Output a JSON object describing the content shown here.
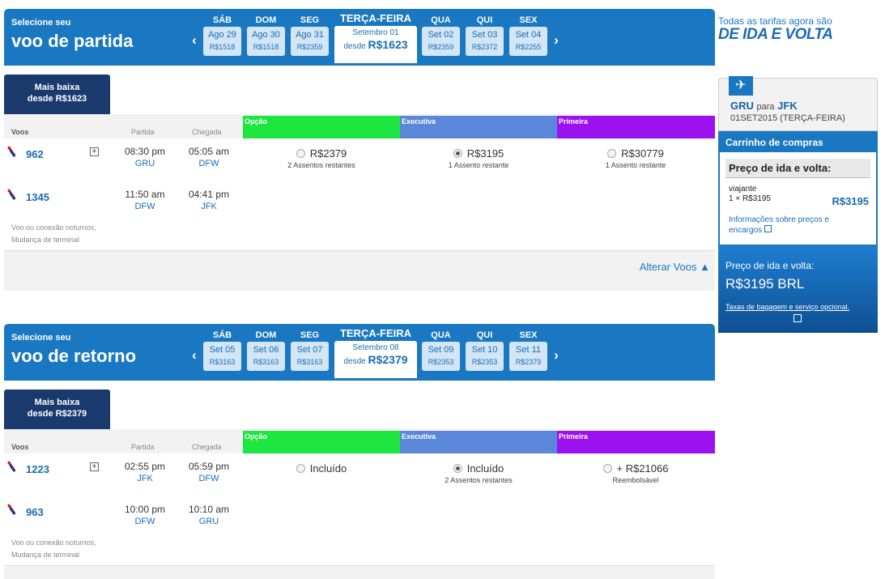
{
  "banner": {
    "line1": "Todas as tarifas agora são",
    "line2": "DE IDA E VOLTA"
  },
  "columns": {
    "flights": "Voos",
    "departure": "Partida",
    "arrival": "Chegada"
  },
  "cabins": [
    {
      "name": "Opção",
      "color": "#1ee640"
    },
    {
      "name": "Executiva",
      "color": "#5a87d9"
    },
    {
      "name": "Primeira",
      "color": "#9b11ef"
    }
  ],
  "outbound": {
    "subtitle": "Selecione seu",
    "title": "voo de partida",
    "days": [
      {
        "name": "SÁB",
        "date": "Ago 29",
        "price": "R$1518"
      },
      {
        "name": "DOM",
        "date": "Ago 30",
        "price": "R$1518"
      },
      {
        "name": "SEG",
        "date": "Ago 31",
        "price": "R$2359"
      }
    ],
    "selected": {
      "name": "TERÇA-FEIRA",
      "date": "Setembro 01",
      "prefix": "desde",
      "price": "R$1623"
    },
    "days_after": [
      {
        "name": "QUA",
        "date": "Set 02",
        "price": "R$2359"
      },
      {
        "name": "QUI",
        "date": "Set 03",
        "price": "R$2372"
      },
      {
        "name": "SEX",
        "date": "Set 04",
        "price": "R$2255"
      }
    ],
    "lowest": {
      "line1": "Mais baixa",
      "line2": "desde R$1623"
    },
    "segments": [
      {
        "flight": "962",
        "dep_time": "08:30 pm",
        "dep_code": "GRU",
        "arr_time": "05:05 am",
        "arr_code": "DFW"
      },
      {
        "flight": "1345",
        "dep_time": "11:50 am",
        "dep_code": "DFW",
        "arr_time": "04:41 pm",
        "arr_code": "JFK"
      }
    ],
    "options": [
      {
        "price": "R$2379",
        "sub": "2 Assentos restantes",
        "selected": false
      },
      {
        "price": "R$3195",
        "sub": "1 Assento restante",
        "selected": true
      },
      {
        "price": "R$30779",
        "sub": "1 Assento restante",
        "selected": false
      }
    ],
    "note1": "Voo ou conexão noturnos,",
    "note2": "Mudança de terminal",
    "change": "Alterar Voos ▲"
  },
  "return": {
    "subtitle": "Selecione seu",
    "title": "voo de retorno",
    "days": [
      {
        "name": "SÁB",
        "date": "Set 05",
        "price": "R$3163"
      },
      {
        "name": "DOM",
        "date": "Set 06",
        "price": "R$3163"
      },
      {
        "name": "SEG",
        "date": "Set 07",
        "price": "R$3163"
      }
    ],
    "selected": {
      "name": "TERÇA-FEIRA",
      "date": "Setembro 08",
      "prefix": "desde",
      "price": "R$2379"
    },
    "days_after": [
      {
        "name": "QUA",
        "date": "Set 09",
        "price": "R$2353"
      },
      {
        "name": "QUI",
        "date": "Set 10",
        "price": "R$2353"
      },
      {
        "name": "SEX",
        "date": "Set 11",
        "price": "R$2379"
      }
    ],
    "lowest": {
      "line1": "Mais baixa",
      "line2": "desde R$2379"
    },
    "segments": [
      {
        "flight": "1223",
        "dep_time": "02:55 pm",
        "dep_code": "JFK",
        "arr_time": "05:59 pm",
        "arr_code": "DFW"
      },
      {
        "flight": "963",
        "dep_time": "10:00 pm",
        "dep_code": "DFW",
        "arr_time": "10:10 am",
        "arr_code": "GRU"
      }
    ],
    "options": [
      {
        "price": "Incluído",
        "sub": "",
        "selected": false
      },
      {
        "price": "Incluído",
        "sub": "2 Assentos restantes",
        "selected": true
      },
      {
        "price": "+ R$21066",
        "sub": "Reembolsável",
        "selected": false
      }
    ],
    "note1": "Voo ou conexão noturnos,",
    "note2": "Mudança de terminal"
  },
  "sidebar": {
    "from": "GRU",
    "to_word": "para",
    "to": "JFK",
    "date": "01SET2015 (TERÇA-FEIRA)",
    "cart_title": "Carrinho de compras",
    "cart_sub": "Preço de ida e volta:",
    "traveler": "viajante",
    "qty": "1 × R$3195",
    "amount": "R$3195",
    "info_link": "Informações sobre preços e encargos",
    "total_label": "Preço de ida e volta:",
    "total": "R$3195 BRL",
    "bag_link": "Taxas de bagagem e serviço opcional."
  }
}
